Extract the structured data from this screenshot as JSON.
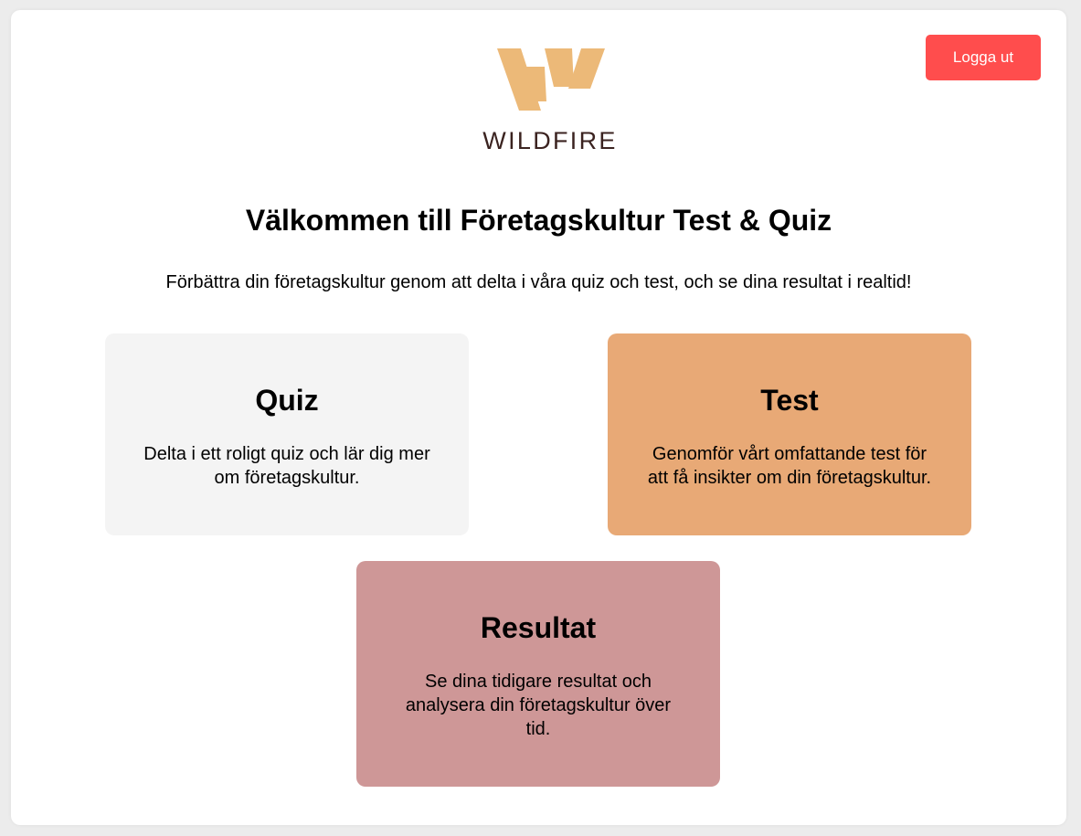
{
  "header": {
    "logout_label": "Logga ut",
    "logo_text": "WILDFIRE"
  },
  "main": {
    "title": "Välkommen till Företagskultur Test & Quiz",
    "subtitle": "Förbättra din företagskultur genom att delta i våra quiz och test, och se dina resultat i realtid!"
  },
  "cards": [
    {
      "title": "Quiz",
      "description": "Delta i ett roligt quiz och lär dig mer om företagskultur.",
      "color": "#f4f4f4"
    },
    {
      "title": "Test",
      "description": "Genomför vårt omfattande test för att få insikter om din företagskultur.",
      "color": "#e8a976"
    },
    {
      "title": "Resultat",
      "description": "Se dina tidigare resultat och analysera din företagskultur över tid.",
      "color": "#ce9797"
    }
  ],
  "colors": {
    "logout_button": "#ff4d4d",
    "logo_mark": "#ecb978",
    "logo_text": "#3b2320",
    "background": "#ececec"
  },
  "icons": {
    "logo_mark": "wildfire-w-logo-icon"
  }
}
